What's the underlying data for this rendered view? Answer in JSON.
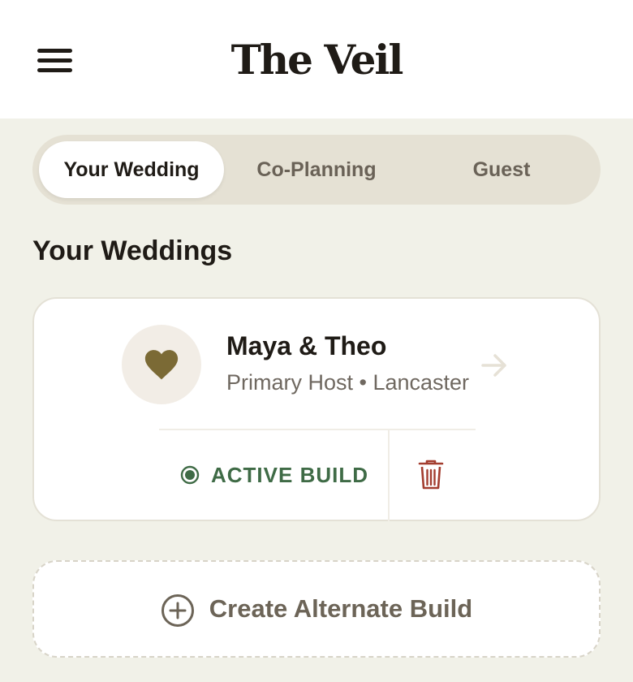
{
  "app": {
    "title": "The Veil"
  },
  "tabs": [
    {
      "label": "Your Wedding",
      "active": true
    },
    {
      "label": "Co-Planning",
      "active": false
    },
    {
      "label": "Guest",
      "active": false
    }
  ],
  "section": {
    "title": "Your Weddings"
  },
  "wedding": {
    "couple": "Maya & Theo",
    "meta": "Primary Host • Lancaster",
    "status": "ACTIVE BUILD"
  },
  "create_build": {
    "label": "Create Alternate Build"
  },
  "icons": {
    "menu": "hamburger-menu-icon",
    "heart": "heart-icon",
    "arrow": "arrow-right-icon",
    "status": "radio-dot-icon",
    "trash": "trash-icon",
    "plus": "plus-circle-icon"
  },
  "colors": {
    "background": "#f1f1e8",
    "accent_gold": "#7b6a35",
    "status_green": "#3f6b46",
    "danger_red": "#a33d2f",
    "tab_track": "#e5e1d4"
  }
}
